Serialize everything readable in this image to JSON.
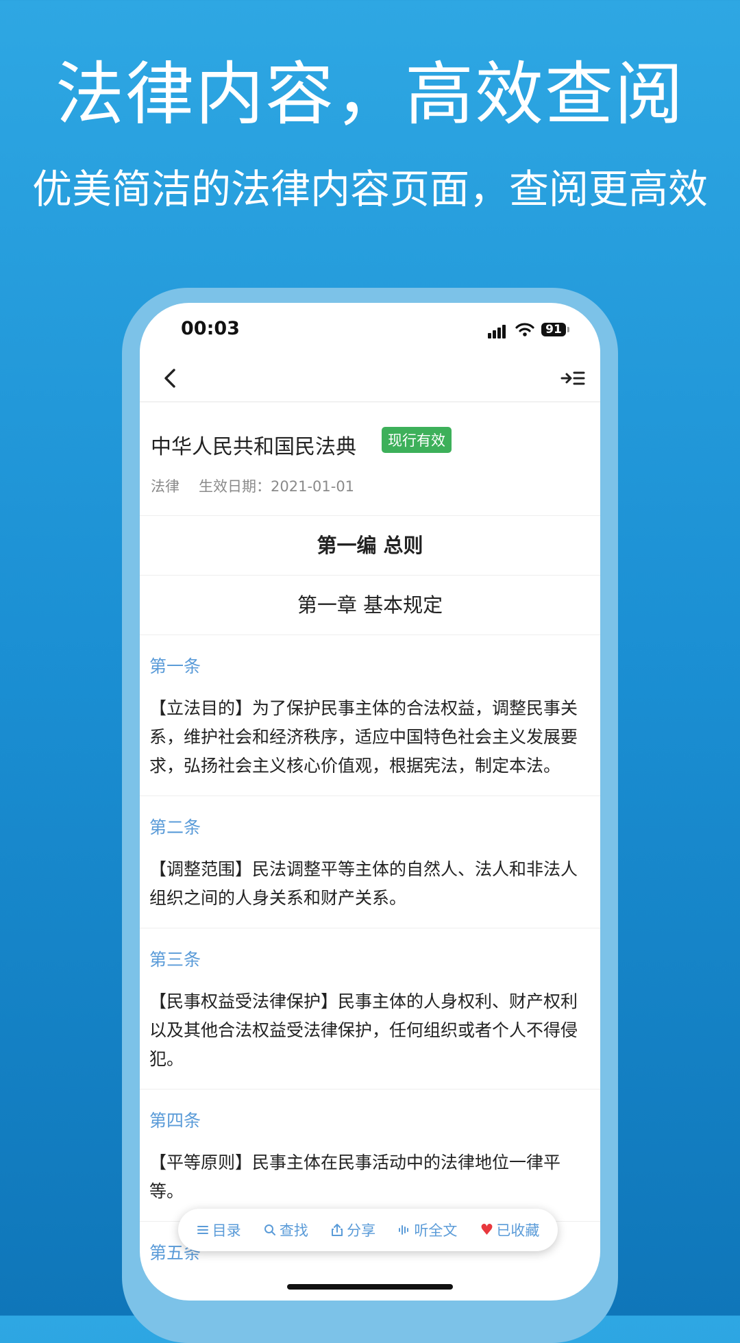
{
  "promo": {
    "headline": "法律内容，高效查阅",
    "subline": "优美简洁的法律内容页面，查阅更高效"
  },
  "statusbar": {
    "time": "00:03",
    "battery": "91"
  },
  "icons": {
    "back": "chevron-left-icon",
    "outline": "outline-indent-icon",
    "signal": "cellular-signal-icon",
    "wifi": "wifi-icon",
    "battery": "battery-icon"
  },
  "document": {
    "title": "中华人民共和国民法典",
    "status": "现行有效",
    "type": "法律",
    "effective_date": "生效日期：2021-01-01",
    "part": "第一编 总则",
    "chapter": "第一章 基本规定",
    "articles": [
      {
        "number": "第一条",
        "text": "【立法目的】为了保护民事主体的合法权益，调整民事关系，维护社会和经济秩序，适应中国特色社会主义发展要求，弘扬社会主义核心价值观，根据宪法，制定本法。"
      },
      {
        "number": "第二条",
        "text": "【调整范围】民法调整平等主体的自然人、法人和非法人组织之间的人身关系和财产关系。"
      },
      {
        "number": "第三条",
        "text": "【民事权益受法律保护】民事主体的人身权利、财产权利以及其他合法权益受法律保护，任何组织或者个人不得侵犯。"
      },
      {
        "number": "第四条",
        "text": "【平等原则】民事主体在民事活动中的法律地位一律平等。"
      },
      {
        "number": "第五条",
        "text": ""
      }
    ]
  },
  "toolbar": {
    "toc": "目录",
    "search": "查找",
    "share": "分享",
    "listen": "听全文",
    "favorited": "已收藏"
  },
  "colors": {
    "accent": "#5a9bd8",
    "badge": "#3db05a",
    "heart": "#e8383d"
  }
}
